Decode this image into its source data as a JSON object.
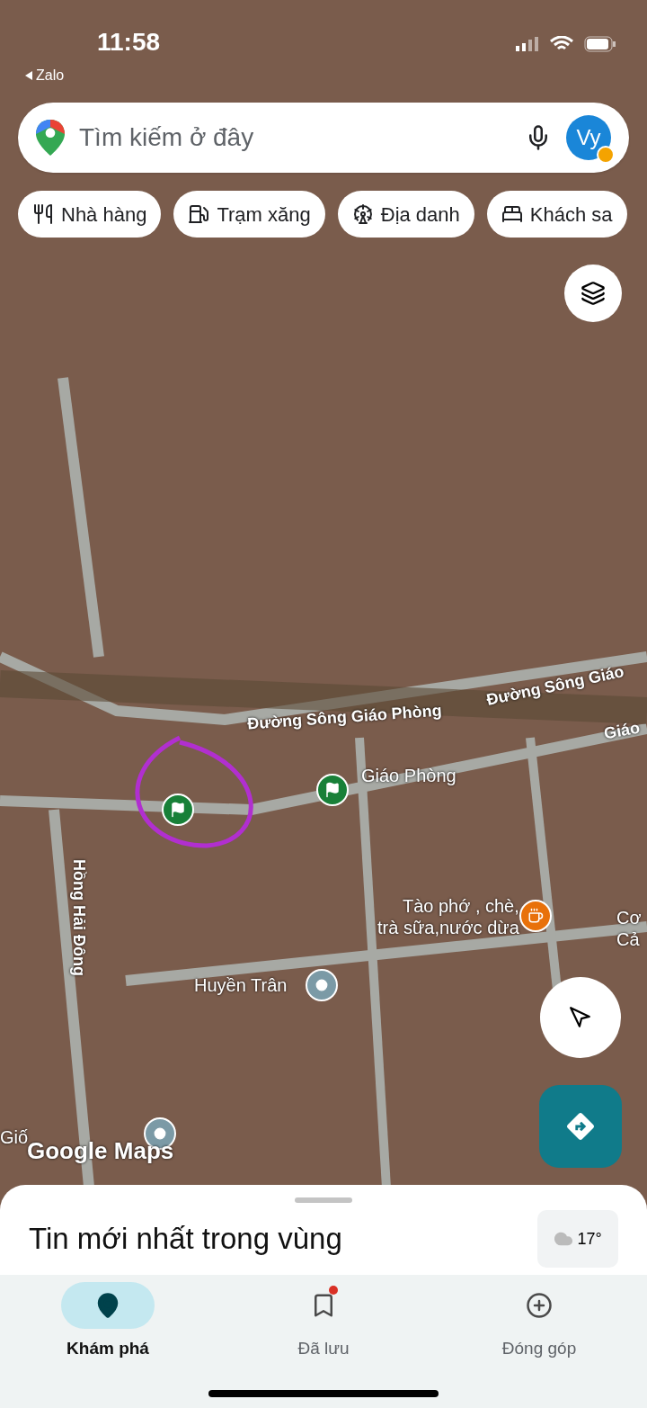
{
  "status_bar": {
    "time": "11:58",
    "back_app": "Zalo"
  },
  "search": {
    "placeholder": "Tìm kiếm ở đây",
    "avatar": "Vy"
  },
  "chips": [
    {
      "label": "Nhà hàng",
      "kind": "restaurant"
    },
    {
      "label": "Trạm xăng",
      "kind": "gas"
    },
    {
      "label": "Địa danh",
      "kind": "landmark"
    },
    {
      "label": "Khách sa",
      "kind": "hotel"
    }
  ],
  "map_labels": [
    {
      "text": "Đường Sông Giáo Phòng",
      "kind": "road"
    },
    {
      "text": "Đường Sông Giáo",
      "kind": "road"
    },
    {
      "text": "Giáo",
      "kind": "road"
    },
    {
      "text": "Hồng Hải Đông",
      "kind": "road"
    },
    {
      "text": "Giáo Phòng",
      "kind": "place"
    },
    {
      "text": "Tào phớ , chè,\ntrà sữa,nước dừa",
      "kind": "place"
    },
    {
      "text": "Huyền Trân",
      "kind": "place"
    },
    {
      "text": "Cơ\nCả",
      "kind": "place"
    },
    {
      "text": "Giố",
      "kind": "place"
    }
  ],
  "map_brand": "Google Maps",
  "sheet": {
    "title": "Tin mới nhất trong vùng",
    "temperature": "17°"
  },
  "nav": [
    {
      "label": "Khám phá",
      "kind": "explore",
      "selected": true,
      "badge": false
    },
    {
      "label": "Đã lưu",
      "kind": "saved",
      "selected": false,
      "badge": true
    },
    {
      "label": "Đóng góp",
      "kind": "contribute",
      "selected": false,
      "badge": false
    }
  ]
}
